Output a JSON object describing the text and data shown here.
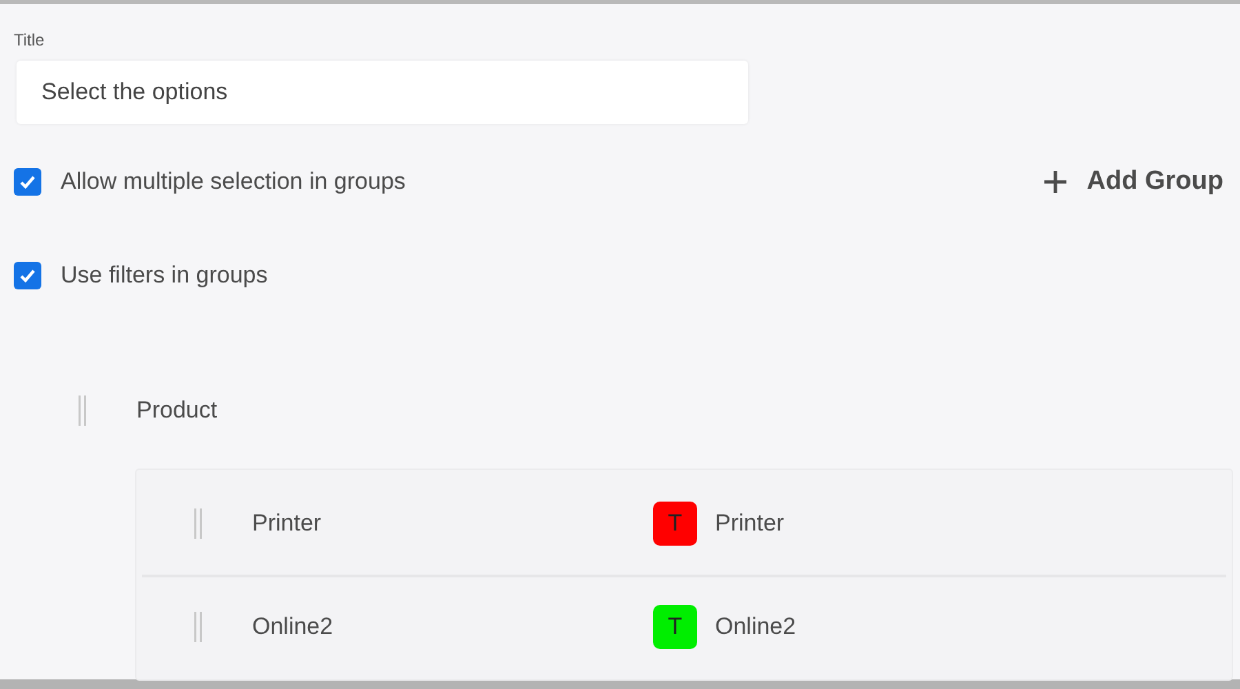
{
  "title_field": {
    "label": "Title",
    "value": "Select the options"
  },
  "options": [
    {
      "label": "Allow multiple selection in groups",
      "checked": true
    },
    {
      "label": "Use filters in groups",
      "checked": true
    }
  ],
  "add_group_button": {
    "label": "Add Group"
  },
  "group": {
    "name": "Product",
    "items": [
      {
        "name": "Printer",
        "tag": "T",
        "color": "#ff0000",
        "value": "Printer"
      },
      {
        "name": "Online2",
        "tag": "T",
        "color": "#00ee00",
        "value": "Online2"
      }
    ]
  }
}
